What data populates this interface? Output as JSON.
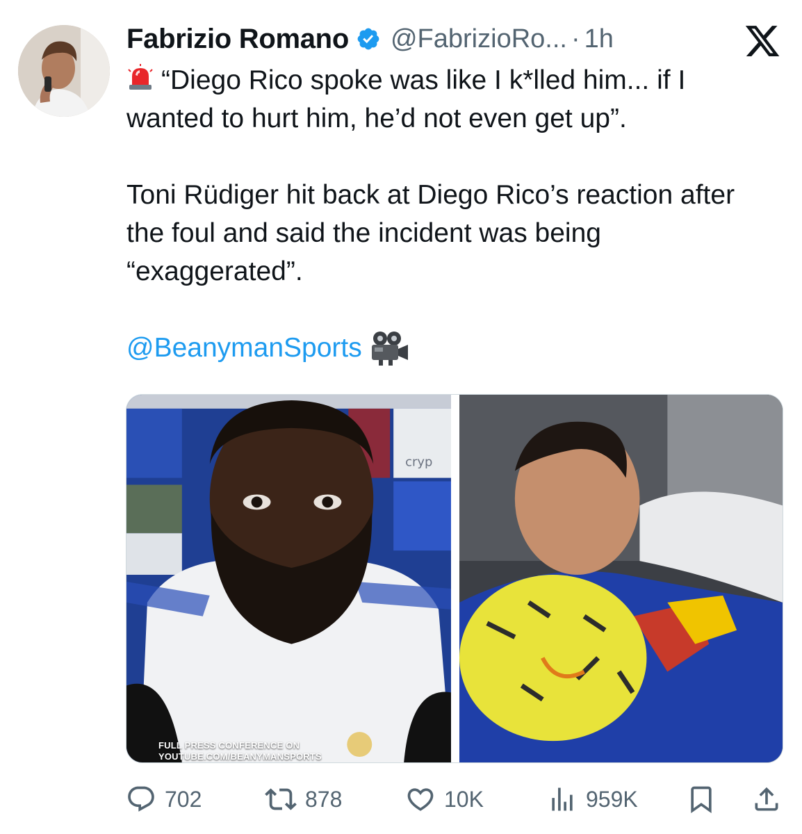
{
  "author": {
    "name": "Fabrizio Romano",
    "handle": "@FabrizioRo...",
    "separator": "·",
    "time": "1h",
    "verified": true
  },
  "tweet": {
    "line1": "“Diego Rico spoke was like I k*lled him... if I wanted to hurt him, he’d not even get up”.",
    "line2": "Toni Rüdiger hit back at Diego Rico’s reaction after the foul and said the incident was being “exaggerated”.",
    "mention": "@BeanymanSports"
  },
  "media": {
    "left_caption_line1": "FULL PRESS CONFERENCE ON",
    "left_caption_line2": "YOUTUBE.COM/BEANYMANSPORTS",
    "left_banner_text": "cryp"
  },
  "actions": {
    "replies": "702",
    "reposts": "878",
    "likes": "10K",
    "views": "959K"
  },
  "colors": {
    "accent": "#1d9bf0",
    "text": "#0f1419",
    "muted": "#536471"
  },
  "icons": [
    "siren-icon",
    "verified-badge-icon",
    "x-logo-icon",
    "movie-camera-icon",
    "reply-icon",
    "repost-icon",
    "like-icon",
    "views-icon",
    "bookmark-icon",
    "share-icon"
  ]
}
